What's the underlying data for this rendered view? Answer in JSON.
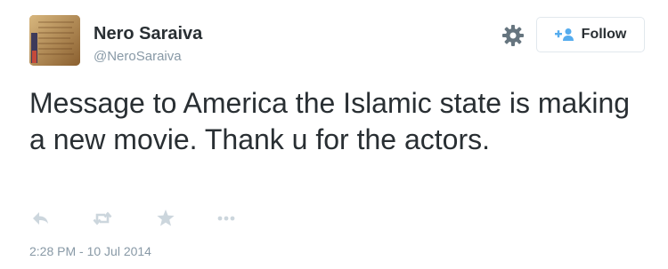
{
  "user": {
    "display_name": "Nero Saraiva",
    "screen_name": "@NeroSaraiva",
    "avatar_icon": "avatar-image"
  },
  "header": {
    "settings_icon": "gear-icon",
    "follow_label": "Follow",
    "follow_icon": "add-user-icon"
  },
  "tweet": {
    "text": "Message to America the Islamic state is making a new movie. Thank u for the actors.",
    "timestamp": "2:28 PM - 10 Jul 2014"
  },
  "actions": [
    {
      "name": "reply",
      "icon": "reply-icon"
    },
    {
      "name": "retweet",
      "icon": "retweet-icon"
    },
    {
      "name": "favorite",
      "icon": "star-icon"
    },
    {
      "name": "more",
      "icon": "more-icon"
    }
  ],
  "colors": {
    "text": "#292f33",
    "muted": "#8899a6",
    "icon": "#ccd6dd",
    "border": "#e1e8ed"
  }
}
